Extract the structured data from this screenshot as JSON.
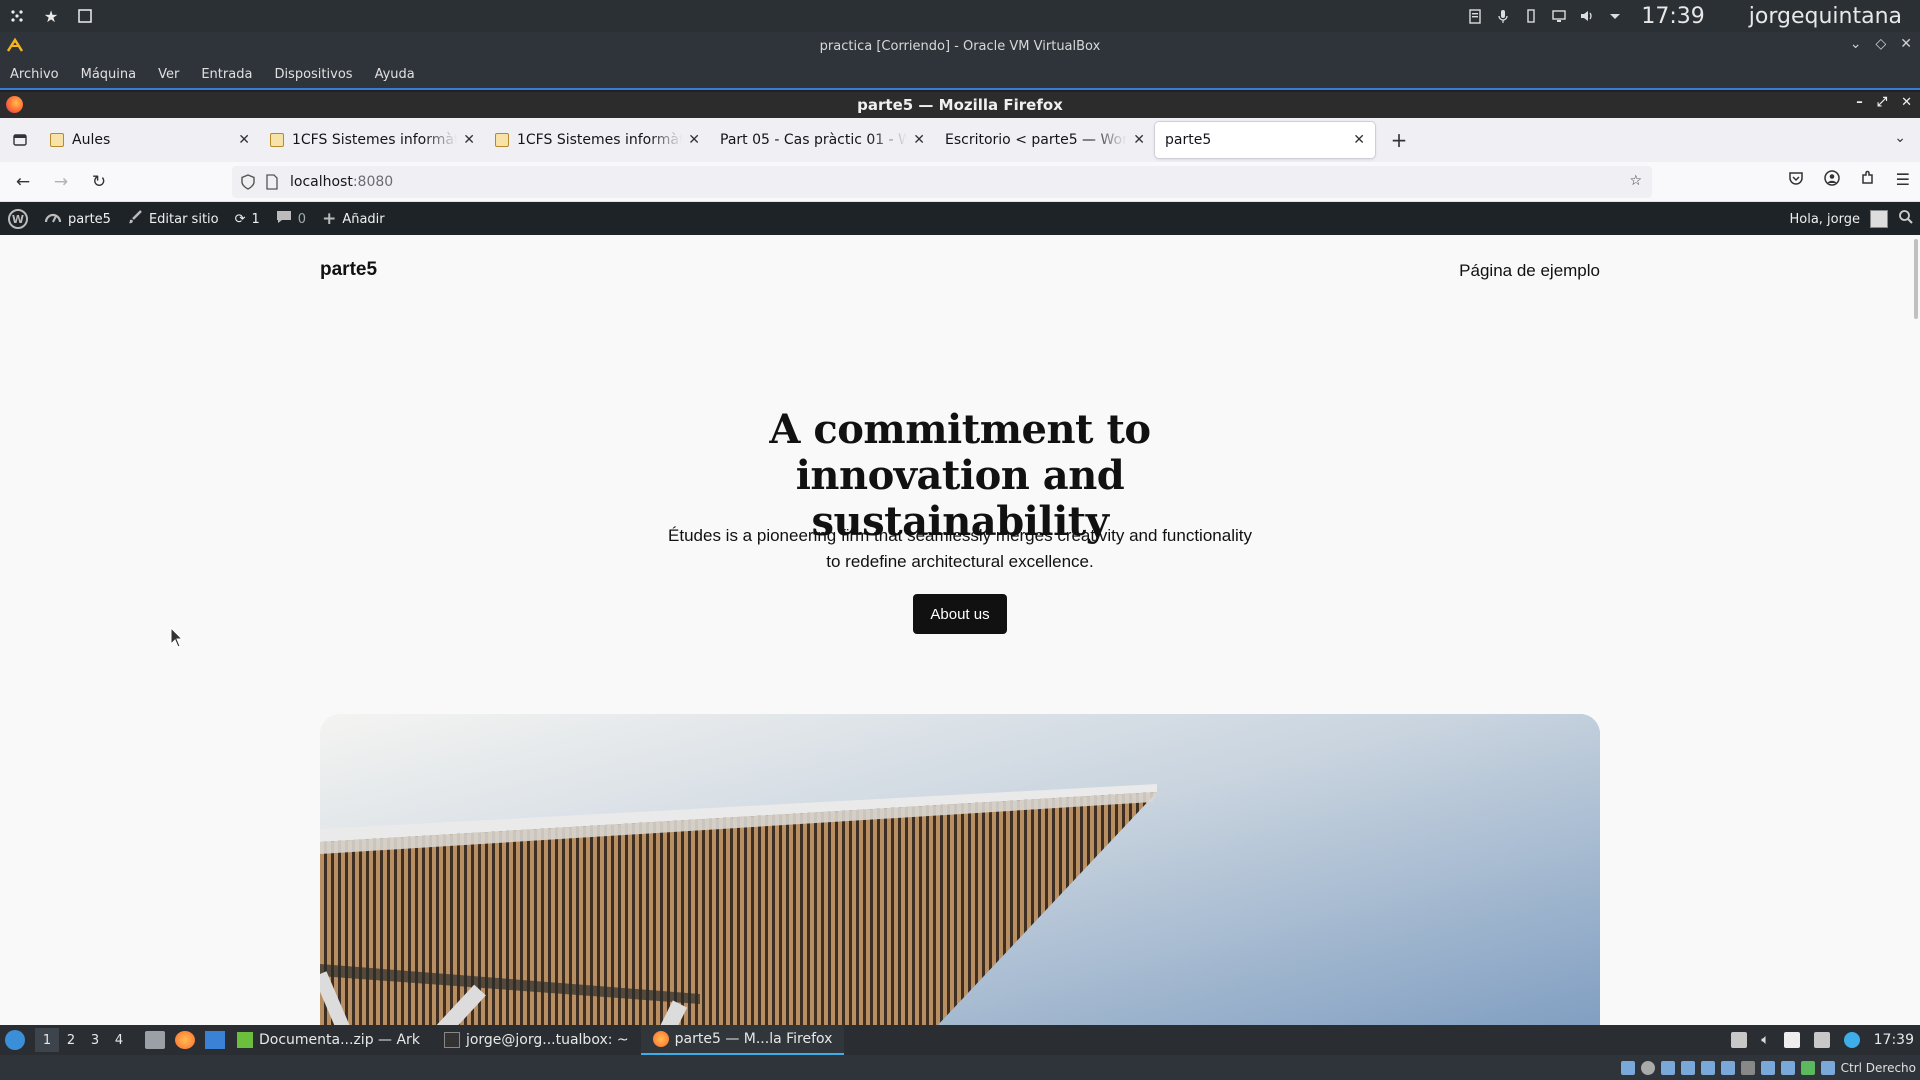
{
  "host": {
    "clock": "17:39",
    "user": "jorgequintana"
  },
  "vbox": {
    "title": "practica [Corriendo] - Oracle VM VirtualBox",
    "menu": [
      "Archivo",
      "Máquina",
      "Ver",
      "Entrada",
      "Dispositivos",
      "Ayuda"
    ],
    "host_key": "Ctrl Derecho"
  },
  "firefox": {
    "window_title": "parte5 — Mozilla Firefox",
    "tabs": [
      {
        "title": "Aules",
        "active": false
      },
      {
        "title": "1CFS Sistemes informàtics",
        "active": false
      },
      {
        "title": "1CFS Sistemes informàtics",
        "active": false
      },
      {
        "title": "Part 05 - Cas pràctic 01 - WordPress",
        "active": false
      },
      {
        "title": "Escritorio < parte5 — WordPress",
        "active": false
      },
      {
        "title": "parte5",
        "active": true
      }
    ],
    "url_host": "localhost",
    "url_port": ":8080"
  },
  "wpbar": {
    "site": "parte5",
    "edit": "Editar sitio",
    "updates": "1",
    "comments": "0",
    "add": "Añadir",
    "greeting": "Hola, jorge"
  },
  "page": {
    "site_title": "parte5",
    "nav_link": "Página de ejemplo",
    "heading": "A commitment to innovation and sustainability",
    "paragraph": "Études is a pioneering firm that seamlessly merges creativity and functionality to redefine architectural excellence.",
    "button": "About us"
  },
  "guest_taskbar": {
    "desktops": [
      "1",
      "2",
      "3",
      "4"
    ],
    "tasks": [
      {
        "label": "Documenta...zip — Ark",
        "active": false
      },
      {
        "label": "jorge@jorg...tualbox: ~",
        "active": false
      },
      {
        "label": "parte5 — M...la Firefox",
        "active": true
      }
    ],
    "clock": "17:39"
  },
  "colors": {
    "wp_admin_bar": "#1d2327",
    "page_bg": "#f9f9f9",
    "button_bg": "#111111",
    "accent": "#3daee9"
  }
}
